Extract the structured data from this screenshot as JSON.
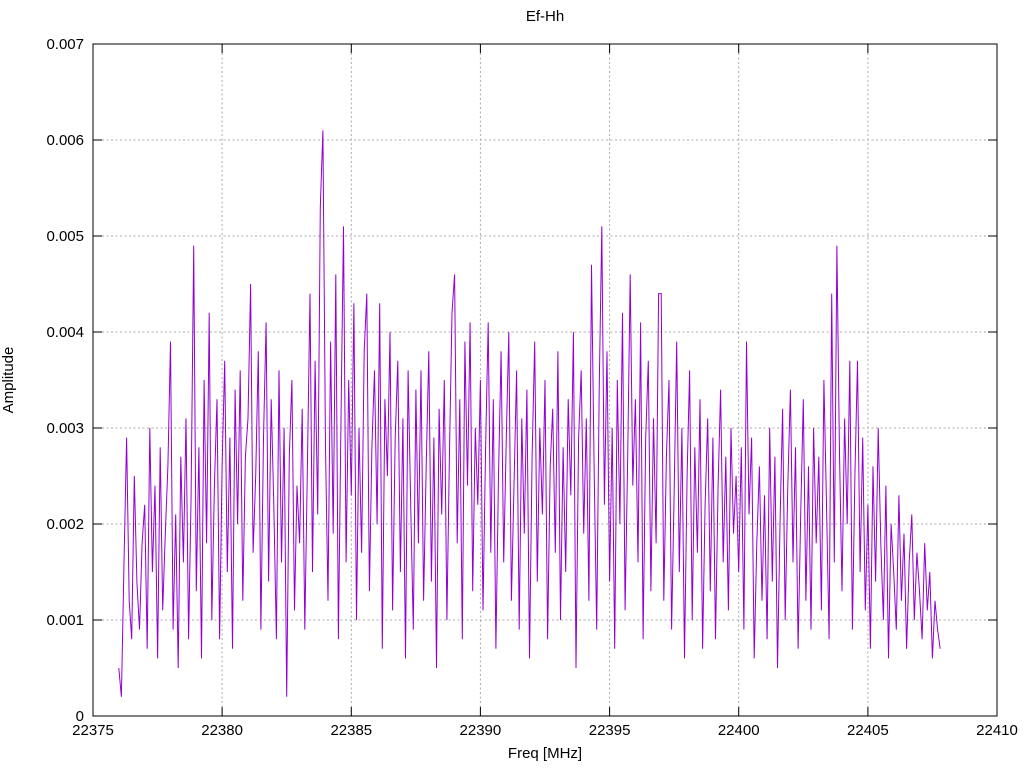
{
  "page": {
    "background": "#ffffff"
  },
  "chart_data": {
    "type": "line",
    "title": "Ef-Hh",
    "xlabel": "Freq [MHz]",
    "ylabel": "Amplitude",
    "xlim": [
      22375,
      22410
    ],
    "ylim": [
      0,
      0.007
    ],
    "xticks": [
      22375,
      22380,
      22385,
      22390,
      22395,
      22400,
      22405,
      22410
    ],
    "xtick_labels": [
      "22375",
      "22380",
      "22385",
      "22390",
      "22395",
      "22400",
      "22405",
      "22410"
    ],
    "yticks": [
      0,
      0.001,
      0.002,
      0.003,
      0.004,
      0.005,
      0.006,
      0.007
    ],
    "ytick_labels": [
      "0",
      "0.001",
      "0.002",
      "0.003",
      "0.004",
      "0.005",
      "0.006",
      "0.007"
    ],
    "grid": true,
    "grid_color": "#aaaaaa",
    "line_color": "#9400d3",
    "axis_color": "#000000",
    "legend": "none",
    "series": [
      {
        "name": "Ef-Hh",
        "x_start": 22376.0,
        "x_step": 0.1,
        "amplitude_scale": 0.0001,
        "amplitudes": [
          5,
          2,
          16,
          29,
          12,
          8,
          25,
          14,
          9,
          18,
          22,
          7,
          30,
          15,
          24,
          6,
          28,
          11,
          19,
          26,
          39,
          9,
          21,
          5,
          27,
          16,
          31,
          8,
          23,
          49,
          13,
          28,
          6,
          35,
          18,
          42,
          10,
          24,
          33,
          8,
          26,
          37,
          15,
          29,
          7,
          34,
          20,
          36,
          12,
          27,
          31,
          45,
          17,
          25,
          38,
          9,
          29,
          41,
          14,
          33,
          22,
          8,
          36,
          16,
          30,
          2,
          27,
          35,
          11,
          24,
          18,
          32,
          9,
          26,
          44,
          15,
          37,
          21,
          53,
          61,
          28,
          12,
          39,
          19,
          46,
          8,
          31,
          51,
          16,
          35,
          23,
          43,
          10,
          30,
          17,
          38,
          44,
          13,
          28,
          36,
          20,
          43,
          7,
          33,
          25,
          40,
          11,
          29,
          37,
          15,
          31,
          6,
          36,
          22,
          9,
          34,
          18,
          36,
          12,
          26,
          38,
          14,
          29,
          5,
          32,
          21,
          35,
          10,
          27,
          42,
          46,
          18,
          33,
          8,
          39,
          24,
          41,
          13,
          30,
          22,
          35,
          11,
          28,
          41,
          17,
          33,
          7,
          25,
          38,
          16,
          29,
          40,
          12,
          24,
          36,
          9,
          31,
          19,
          34,
          6,
          27,
          39,
          14,
          30,
          21,
          35,
          8,
          26,
          32,
          17,
          38,
          10,
          28,
          15,
          33,
          23,
          40,
          5,
          29,
          36,
          19,
          31,
          12,
          47,
          26,
          9,
          34,
          51,
          22,
          38,
          14,
          30,
          7,
          35,
          20,
          42,
          11,
          27,
          46,
          24,
          33,
          16,
          41,
          8,
          29,
          37,
          13,
          31,
          18,
          44,
          44,
          12,
          27,
          35,
          9,
          23,
          39,
          15,
          30,
          6,
          25,
          36,
          10,
          28,
          17,
          33,
          7,
          22,
          31,
          13,
          29,
          8,
          24,
          34,
          16,
          27,
          11,
          30,
          19,
          25,
          15,
          28,
          9,
          39,
          21,
          29,
          6,
          18,
          26,
          12,
          23,
          8,
          30,
          14,
          27,
          5,
          20,
          32,
          10,
          24,
          34,
          16,
          28,
          7,
          21,
          33,
          12,
          26,
          9,
          30,
          18,
          27,
          11,
          35,
          22,
          8,
          44,
          16,
          49,
          28,
          13,
          31,
          20,
          37,
          9,
          25,
          37,
          15,
          29,
          11,
          22,
          7,
          26,
          14,
          30,
          18,
          10,
          24,
          6,
          20,
          15,
          9,
          23,
          12,
          19,
          7,
          16,
          21,
          10,
          17,
          13,
          8,
          18,
          11,
          15,
          6,
          12,
          9,
          7
        ]
      }
    ]
  }
}
